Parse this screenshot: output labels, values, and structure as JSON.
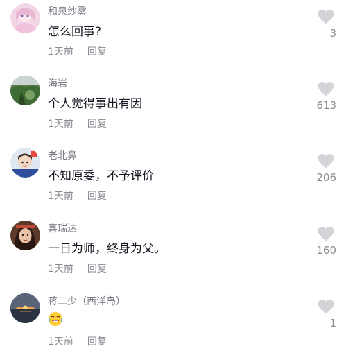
{
  "colors": {
    "username": "#7a7c85",
    "text": "#161823",
    "meta": "#8a8b91",
    "heart": "#d3d4d8"
  },
  "comments": [
    {
      "username": "和泉纱雾",
      "text": "怎么回事?",
      "time": "1天前",
      "reply": "回复",
      "likes": "3",
      "avatar_icon": "anime-girl-avatar"
    },
    {
      "username": "海岩",
      "text": "个人觉得事出有因",
      "time": "1天前",
      "reply": "回复",
      "likes": "613",
      "avatar_icon": "nature-photo-avatar"
    },
    {
      "username": "老北鼻",
      "text": "不知原委，不予评价",
      "time": "1天前",
      "reply": "回复",
      "likes": "206",
      "avatar_icon": "cartoon-avatar"
    },
    {
      "username": "喜瑞达",
      "text": "一日为师，终身为父。",
      "time": "1天前",
      "reply": "回复",
      "likes": "160",
      "avatar_icon": "woman-portrait-avatar"
    },
    {
      "username": "蒋二少（西洋岛）",
      "text": "",
      "emoji": "laughing-crying-emoji",
      "time": "1天前",
      "reply": "回复",
      "likes": "1",
      "avatar_icon": "sunset-photo-avatar"
    }
  ]
}
